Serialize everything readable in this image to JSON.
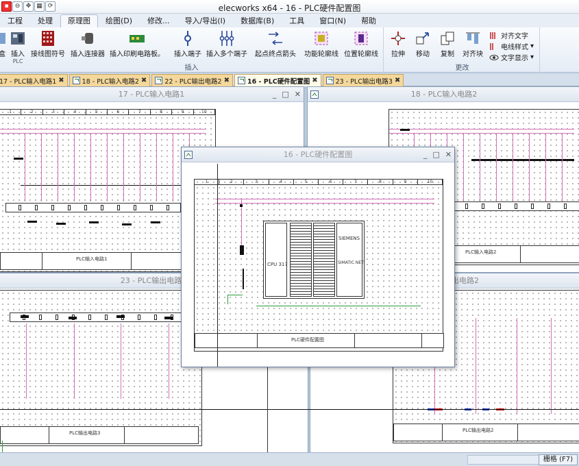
{
  "app": {
    "title": "elecworks x64 - 16 - PLC硬件配置图"
  },
  "quick_access": [
    "close-file",
    "save",
    "zoom",
    "zoom-out",
    "pan",
    "grid",
    "sync"
  ],
  "menu": {
    "tabs": [
      "工程",
      "处理",
      "原理图",
      "绘图(D)",
      "修改...",
      "导入/导出(I)",
      "数据库(B)",
      "工具",
      "窗口(N)",
      "帮助"
    ],
    "active": "原理图"
  },
  "ribbon": {
    "insert_group": {
      "label": "插入",
      "buttons": {
        "partial": "盒",
        "insert_plc": "插入",
        "insert_plc_sub": "PLC",
        "wire_symbol": "接线图符号",
        "insert_connector": "插入连接器",
        "insert_pcb": "插入印刷电路板。",
        "insert_terminal": "插入端子",
        "insert_multi_terminal": "插入多个端子",
        "start_end_arrow": "起点终点箭头",
        "function_outline": "功能轮廓线",
        "location_outline": "位置轮廓线"
      }
    },
    "modify_group": {
      "label": "更改",
      "buttons": {
        "stretch": "拉伸",
        "move": "移动",
        "copy": "复制",
        "align_blocks": "对齐块",
        "align_text": "对齐文字",
        "wire_style": "电线样式",
        "text_display": "文字显示"
      }
    }
  },
  "doc_tabs": [
    {
      "label": "17 - PLC输入电路1",
      "close": "✖"
    },
    {
      "label": "18 - PLC输入电路2",
      "close": "✖"
    },
    {
      "label": "22 - PLC输出电路2",
      "close": "✖"
    },
    {
      "label": "16 - PLC硬件配置图",
      "close": "✖",
      "active": true
    },
    {
      "label": "23 - PLC输出电路3",
      "close": "✖"
    }
  ],
  "windows": {
    "w17": {
      "title": "17 - PLC输入电路1",
      "sheet_title": "PLC输入电路1"
    },
    "w18": {
      "title": "18 - PLC输入电路2",
      "sheet_title": "PLC输入电路2"
    },
    "w23": {
      "title": "23 - PLC输出电路3",
      "sheet_title": "PLC输出电路3"
    },
    "w22": {
      "title_partial": "出电路2",
      "sheet_title": "PLC输出电路2"
    },
    "w16": {
      "title": "16 - PLC硬件配置图",
      "sheet_title": "PLC硬件配置图",
      "plc": {
        "brand": "SIEMENS",
        "model": "SIMATIC NET",
        "cpu_label": "CPU 317"
      }
    }
  },
  "ruler_numbers": [
    "1",
    "2",
    "3",
    "4",
    "5",
    "6",
    "7",
    "8",
    "9",
    "10"
  ],
  "window_controls": {
    "min": "_",
    "max": "□",
    "close": "✕"
  },
  "statusbar": {
    "grid": "栅格 (F7)"
  }
}
